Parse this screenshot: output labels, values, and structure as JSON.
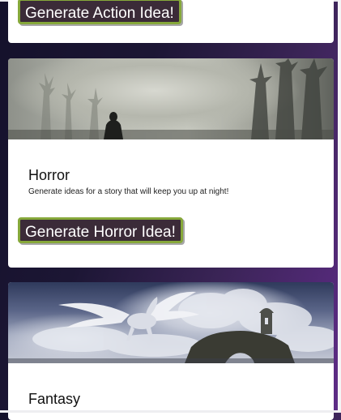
{
  "cards": {
    "action": {
      "button_label": "Generate Action Idea!"
    },
    "horror": {
      "image_subject": "foggy-forest-figure",
      "title": "Horror",
      "description": "Generate ideas for a story that will keep you up at night!",
      "button_label": "Generate Horror Idea!"
    },
    "fantasy": {
      "image_subject": "pegasus-clouds-castle",
      "title": "Fantasy"
    }
  },
  "colors": {
    "background_dark": "#14112b",
    "background_purple": "#5f2c88",
    "button_fill": "#3b2b38",
    "button_border": "#86a83a",
    "card": "#ffffff"
  }
}
